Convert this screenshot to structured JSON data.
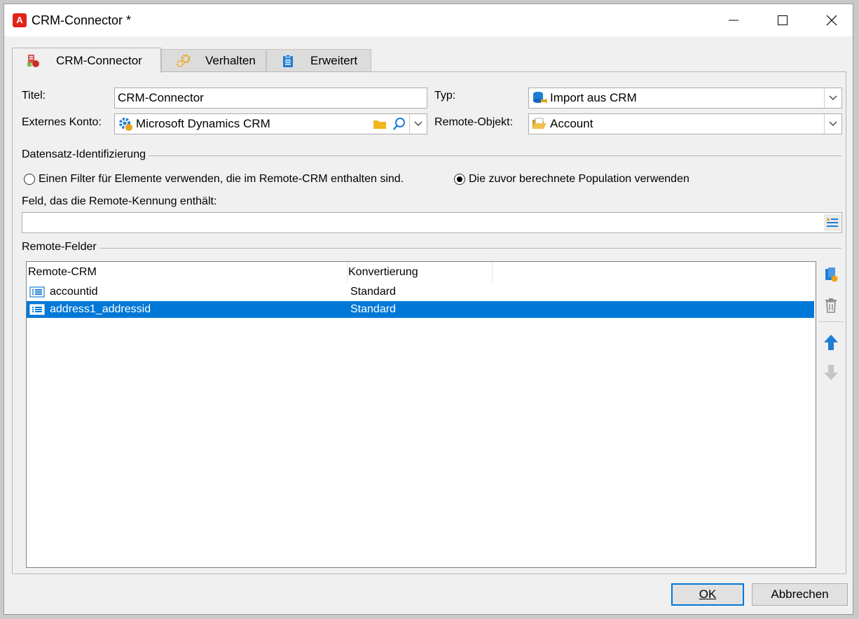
{
  "window": {
    "title": "CRM-Connector *",
    "app_icon_letter": "A",
    "controls": [
      "minimize-icon",
      "maximize-icon",
      "close-icon"
    ]
  },
  "tabs": [
    {
      "label": "CRM-Connector",
      "icon": "crm-connector-icon",
      "active": true
    },
    {
      "label": "Verhalten",
      "icon": "gears-icon",
      "active": false
    },
    {
      "label": "Erweitert",
      "icon": "clipboard-icon",
      "active": false
    }
  ],
  "form": {
    "title_label": "Titel:",
    "title_value": "CRM-Connector",
    "type_label": "Typ:",
    "type_value": "Import aus CRM",
    "external_account_label": "Externes Konto:",
    "external_account_value": "Microsoft Dynamics CRM",
    "remote_object_label": "Remote-Objekt:",
    "remote_object_value": "Account"
  },
  "identification": {
    "group_title": "Datensatz-Identifizierung",
    "option_filter": "Einen Filter für Elemente verwenden, die im Remote-CRM enthalten sind.",
    "option_population": "Die zuvor berechnete Population verwenden",
    "selected": "population",
    "remote_id_field_label": "Feld, das die Remote-Kennung enthält:",
    "remote_id_field_value": ""
  },
  "remote_fields": {
    "group_title": "Remote-Felder",
    "columns": [
      "Remote-CRM",
      "Konvertierung"
    ],
    "rows": [
      {
        "name": "accountid",
        "conversion": "Standard",
        "selected": false
      },
      {
        "name": "address1_addressid",
        "conversion": "Standard",
        "selected": true
      }
    ]
  },
  "buttons": {
    "ok": "OK",
    "cancel": "Abbrechen"
  },
  "colors": {
    "selection": "#0078d7",
    "accent_blue": "#1e7ed3",
    "app_red": "#e2231a"
  }
}
